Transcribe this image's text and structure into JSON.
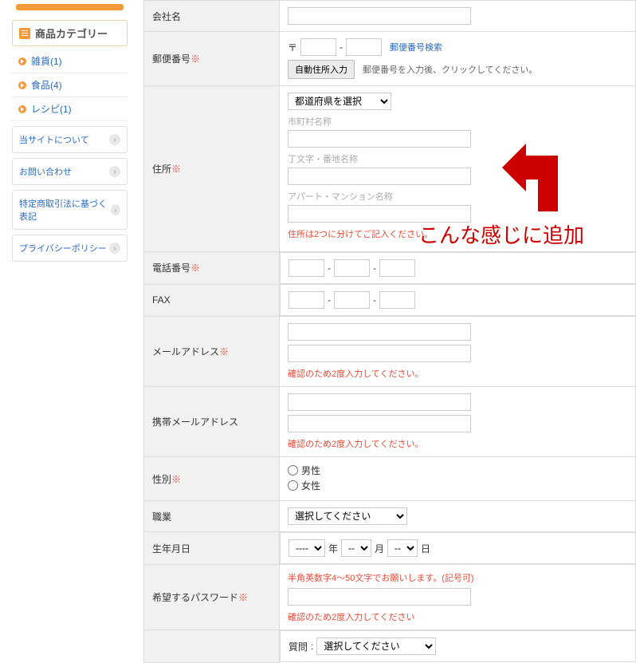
{
  "sidebar": {
    "cat_header": "商品カテゴリー",
    "items": [
      {
        "label": "雑貨(1)"
      },
      {
        "label": "食品(4)"
      },
      {
        "label": "レシピ(1)"
      }
    ],
    "buttons": [
      {
        "label": "当サイトについて"
      },
      {
        "label": "お問い合わせ"
      },
      {
        "label": "特定商取引法に基づく表記"
      },
      {
        "label": "プライバシーポリシー"
      }
    ]
  },
  "form": {
    "rows": {
      "company": {
        "label": "会社名"
      },
      "postal": {
        "label": "郵便番号",
        "prefix": "〒",
        "dash": "-",
        "link": "郵便番号検索",
        "btn": "自動住所入力",
        "hint": "郵便番号を入力後、クリックしてください。"
      },
      "address": {
        "label": "住所",
        "pref_placeholder": "都道府県を選択",
        "city_label": "市町村名称",
        "street_label": "丁文字・番地名称",
        "bldg_label": "アパート・マンション名称",
        "note": "住所は2つに分けてご記入ください。"
      },
      "tel": {
        "label": "電話番号",
        "dash": "-"
      },
      "fax": {
        "label": "FAX",
        "dash": "-"
      },
      "email": {
        "label": "メールアドレス",
        "note": "確認のため2度入力してください。"
      },
      "mobile_email": {
        "label": "携帯メールアドレス",
        "note": "確認のため2度入力してください。"
      },
      "gender": {
        "label": "性別",
        "opts": [
          "男性",
          "女性"
        ]
      },
      "job": {
        "label": "職業",
        "placeholder": "選択してください"
      },
      "birthday": {
        "label": "生年月日",
        "y_placeholder": "----",
        "m_placeholder": "--",
        "d_placeholder": "--",
        "y": "年",
        "m": "月",
        "d": "日"
      },
      "password": {
        "label": "希望するパスワード",
        "hint": "半角英数字4～50文字でお願いします。(記号可)",
        "note": "確認のため2度入力してください"
      },
      "reminder": {
        "label": "質問",
        "placeholder": "選択してください"
      }
    }
  },
  "annotation": "こんな感じに追加"
}
